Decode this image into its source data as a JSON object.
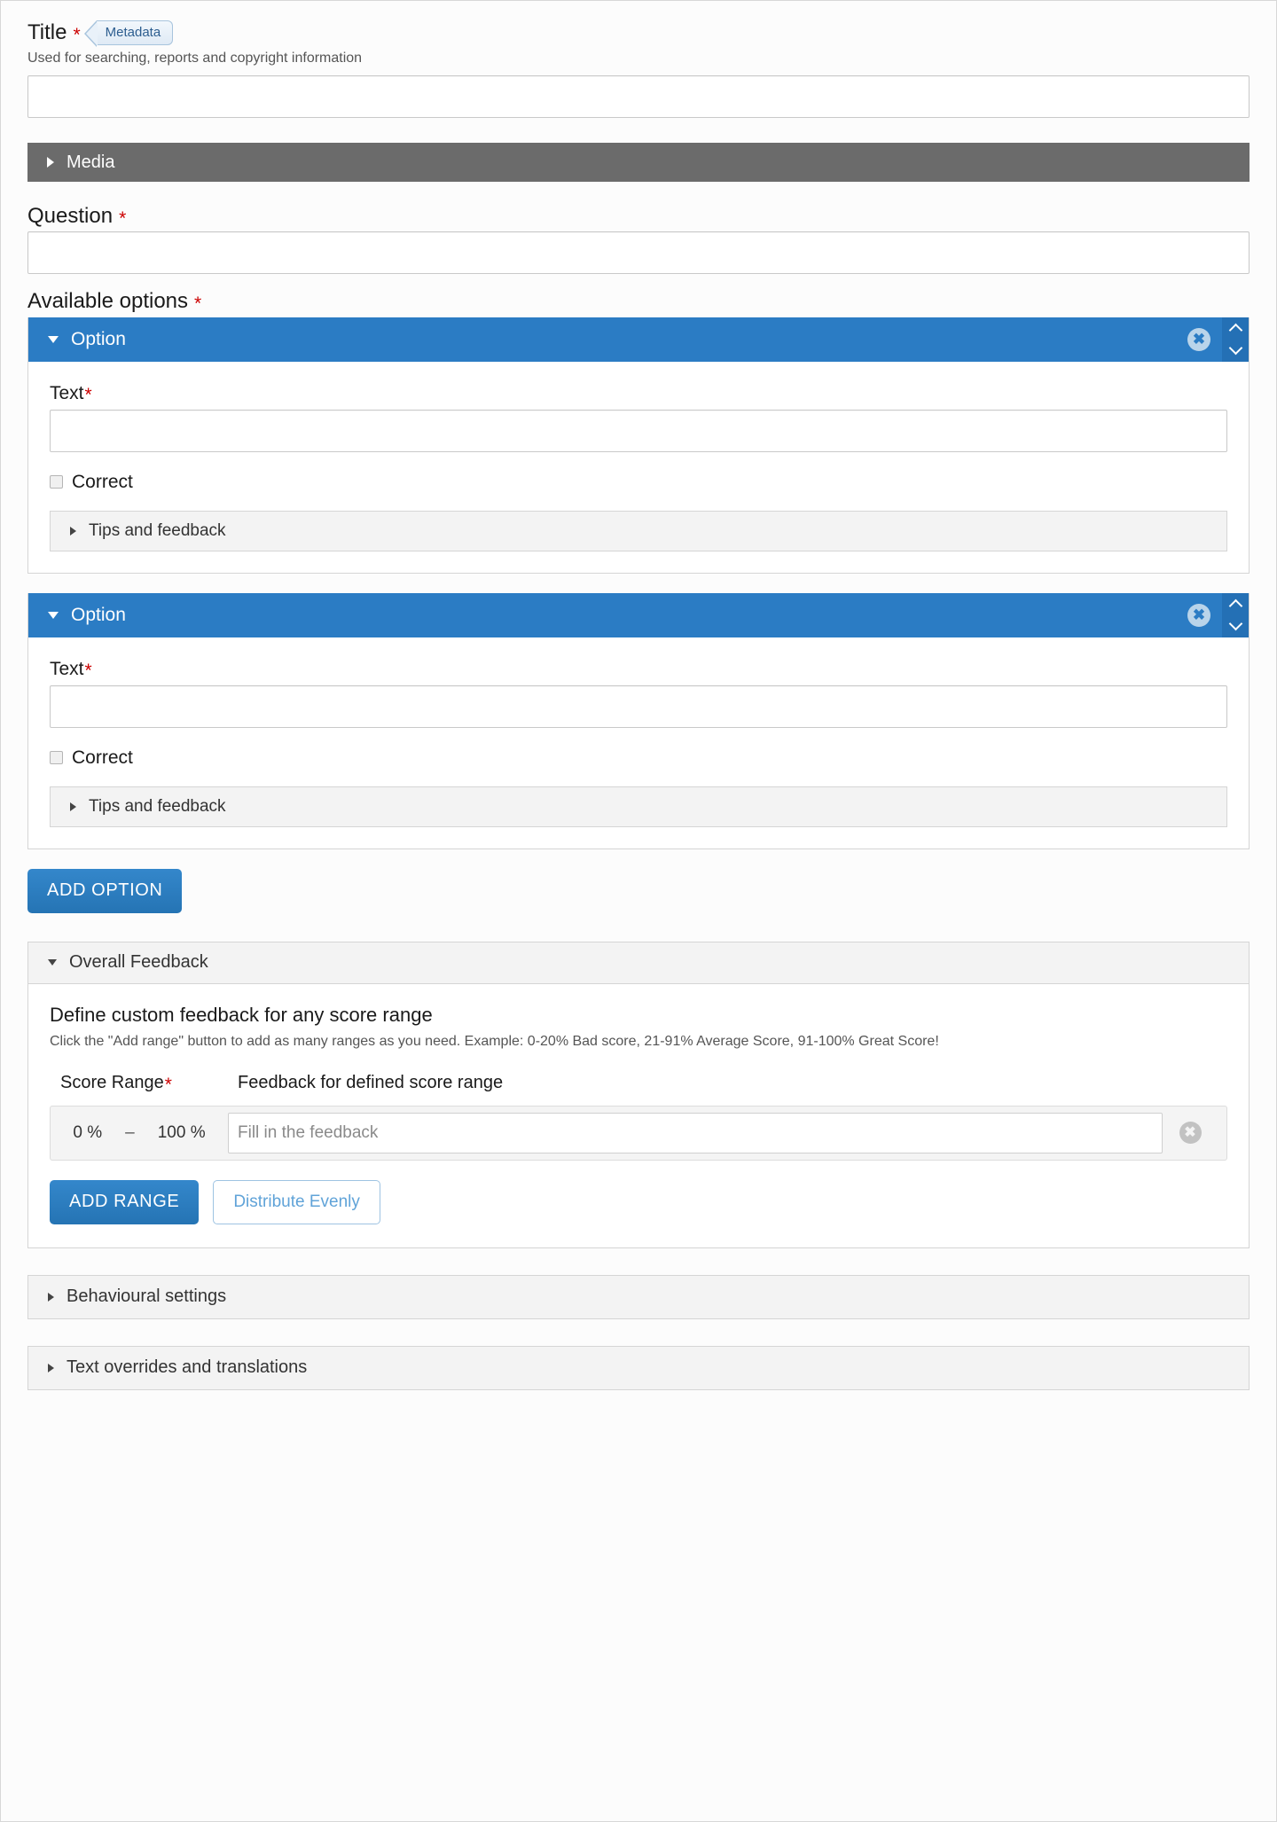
{
  "title_field": {
    "label": "Title",
    "required_mark": "*",
    "metadata_badge": "Metadata",
    "description": "Used for searching, reports and copyright information",
    "value": "",
    "placeholder": ""
  },
  "media_section": {
    "label": "Media",
    "expanded": false,
    "toggle_icon": "triangle-right-icon"
  },
  "question_field": {
    "label": "Question",
    "required_mark": "*",
    "value": "",
    "placeholder": ""
  },
  "available_options": {
    "label": "Available options",
    "required_mark": "*",
    "options": [
      {
        "header_label": "Option",
        "toggle_icon": "triangle-down-icon",
        "delete_icon": "circle-x-icon",
        "move_up_icon": "chevron-up-icon",
        "move_down_icon": "chevron-down-icon",
        "text_label": "Text",
        "text_required_mark": "*",
        "text_value": "",
        "text_placeholder": "",
        "correct_label": "Correct",
        "correct_checked": false,
        "tips_label": "Tips and feedback",
        "tips_icon": "triangle-right-icon"
      },
      {
        "header_label": "Option",
        "toggle_icon": "triangle-down-icon",
        "delete_icon": "circle-x-icon",
        "move_up_icon": "chevron-up-icon",
        "move_down_icon": "chevron-down-icon",
        "text_label": "Text",
        "text_required_mark": "*",
        "text_value": "",
        "text_placeholder": "",
        "correct_label": "Correct",
        "correct_checked": false,
        "tips_label": "Tips and feedback",
        "tips_icon": "triangle-right-icon"
      }
    ],
    "add_option_button": "ADD OPTION"
  },
  "overall_feedback": {
    "header_label": "Overall Feedback",
    "toggle_icon": "triangle-down-icon",
    "title": "Define custom feedback for any score range",
    "help": "Click the \"Add range\" button to add as many ranges as you need. Example: 0-20% Bad score, 21-91% Average Score, 91-100% Great Score!",
    "col_score_range": "Score Range",
    "col_score_range_required": "*",
    "col_feedback": "Feedback for defined score range",
    "ranges": [
      {
        "from": "0 %",
        "dash": "–",
        "to": "100 %",
        "feedback_value": "",
        "feedback_placeholder": "Fill in the feedback",
        "remove_icon": "circle-x-icon"
      }
    ],
    "add_range_button": "ADD RANGE",
    "distribute_button": "Distribute Evenly"
  },
  "behavioural_settings": {
    "label": "Behavioural settings",
    "toggle_icon": "triangle-right-icon"
  },
  "text_overrides": {
    "label": "Text overrides and translations",
    "toggle_icon": "triangle-right-icon"
  },
  "colors": {
    "accent_blue": "#2b7cc4",
    "media_gray": "#6b6b6b",
    "required_red": "#cc0000"
  }
}
